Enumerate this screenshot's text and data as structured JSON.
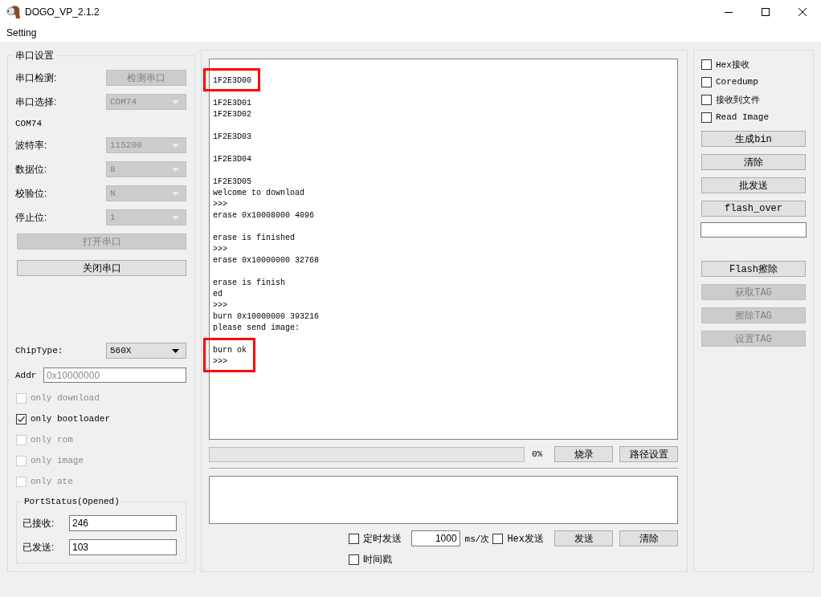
{
  "window": {
    "title": "DOGO_VP_2.1.2"
  },
  "menu": [
    {
      "label": "Setting"
    }
  ],
  "serial": {
    "title": "串口设置",
    "rows": [
      {
        "kind": "button",
        "label": "串口检测:",
        "value": "检测串口",
        "disabled": true
      },
      {
        "kind": "combo",
        "label": "串口选择:",
        "value": "COM74",
        "disabled": true
      },
      {
        "kind": "text",
        "value": "COM74",
        "disabled": false
      },
      {
        "kind": "combo",
        "label": "波特率:",
        "value": "115200",
        "disabled": true
      },
      {
        "kind": "combo",
        "label": "数据位:",
        "value": "8",
        "disabled": true
      },
      {
        "kind": "combo",
        "label": "校验位:",
        "value": "N",
        "disabled": true
      },
      {
        "kind": "combo",
        "label": "停止位:",
        "value": "1",
        "disabled": true
      }
    ],
    "buttons": [
      {
        "label": "打开串口",
        "disabled": true
      },
      {
        "label": "关闭串口",
        "disabled": false
      }
    ],
    "chip_type": {
      "label": "ChipType:",
      "value": "560X",
      "disabled": false
    },
    "addr": {
      "label": "Addr",
      "placeholder": "0x10000000"
    },
    "options": [
      {
        "label": "only download",
        "checked": false,
        "disabled": true
      },
      {
        "label": "only bootloader",
        "checked": true,
        "disabled": false
      },
      {
        "label": "only rom",
        "checked": false,
        "disabled": true
      },
      {
        "label": "only image",
        "checked": false,
        "disabled": true
      },
      {
        "label": "only ate",
        "checked": false,
        "disabled": true
      }
    ],
    "port_status": {
      "title": "PortStatus(Opened)",
      "fields": [
        {
          "label": "已接收:",
          "value": "246"
        },
        {
          "label": "已发送:",
          "value": "103"
        }
      ]
    }
  },
  "log": {
    "blocks": [
      {
        "lines": [
          "1F2E3D00"
        ],
        "highlighted": true
      },
      {
        "lines": [
          "1F2E3D01",
          "1F2E3D02"
        ],
        "highlighted": false
      },
      {
        "lines": [
          "1F2E3D03"
        ],
        "highlighted": false
      },
      {
        "lines": [
          "1F2E3D04"
        ],
        "highlighted": false
      },
      {
        "lines": [
          "1F2E3D05",
          "welcome to download",
          ">>>",
          "erase 0x10008000 4096"
        ],
        "highlighted": false
      },
      {
        "lines": [
          "erase is finished",
          ">>>",
          "erase 0x10000000 32768"
        ],
        "highlighted": false
      },
      {
        "lines": [
          "erase is finish",
          "ed",
          ">>>",
          "burn 0x10000000 393216",
          "please send image:"
        ],
        "highlighted": false
      },
      {
        "lines": [
          "burn ok",
          ">>>"
        ],
        "highlighted": true
      }
    ]
  },
  "progress": {
    "level": 0,
    "reading": "0%"
  },
  "burn_buttons": [
    {
      "label": "烧录"
    },
    {
      "label": "路径设置"
    }
  ],
  "send": {
    "timed": {
      "label": "定时发送",
      "checked": false
    },
    "interval": {
      "value": "1000",
      "unit": "ms/次"
    },
    "hex": {
      "label": "Hex发送",
      "checked": false
    },
    "buttons": [
      {
        "label": "发送"
      },
      {
        "label": "清除"
      }
    ],
    "timestamp": {
      "label": "时间戳",
      "checked": false
    }
  },
  "receive_options": [
    {
      "label": "Hex接收",
      "checked": false
    },
    {
      "label": "Coredump",
      "checked": false
    },
    {
      "label": "接收到文件",
      "checked": false
    },
    {
      "label": "Read Image",
      "checked": false
    }
  ],
  "tool_buttons": [
    {
      "label": "生成bin",
      "disabled": false
    },
    {
      "label": "清除",
      "disabled": false
    },
    {
      "label": "批发送",
      "disabled": false
    },
    {
      "label": "flash_over",
      "disabled": false
    }
  ],
  "tag_buttons": [
    {
      "label": "Flash擦除",
      "disabled": false
    },
    {
      "label": "获取TAG",
      "disabled": true
    },
    {
      "label": "擦除TAG",
      "disabled": true
    },
    {
      "label": "设置TAG",
      "disabled": true
    }
  ]
}
